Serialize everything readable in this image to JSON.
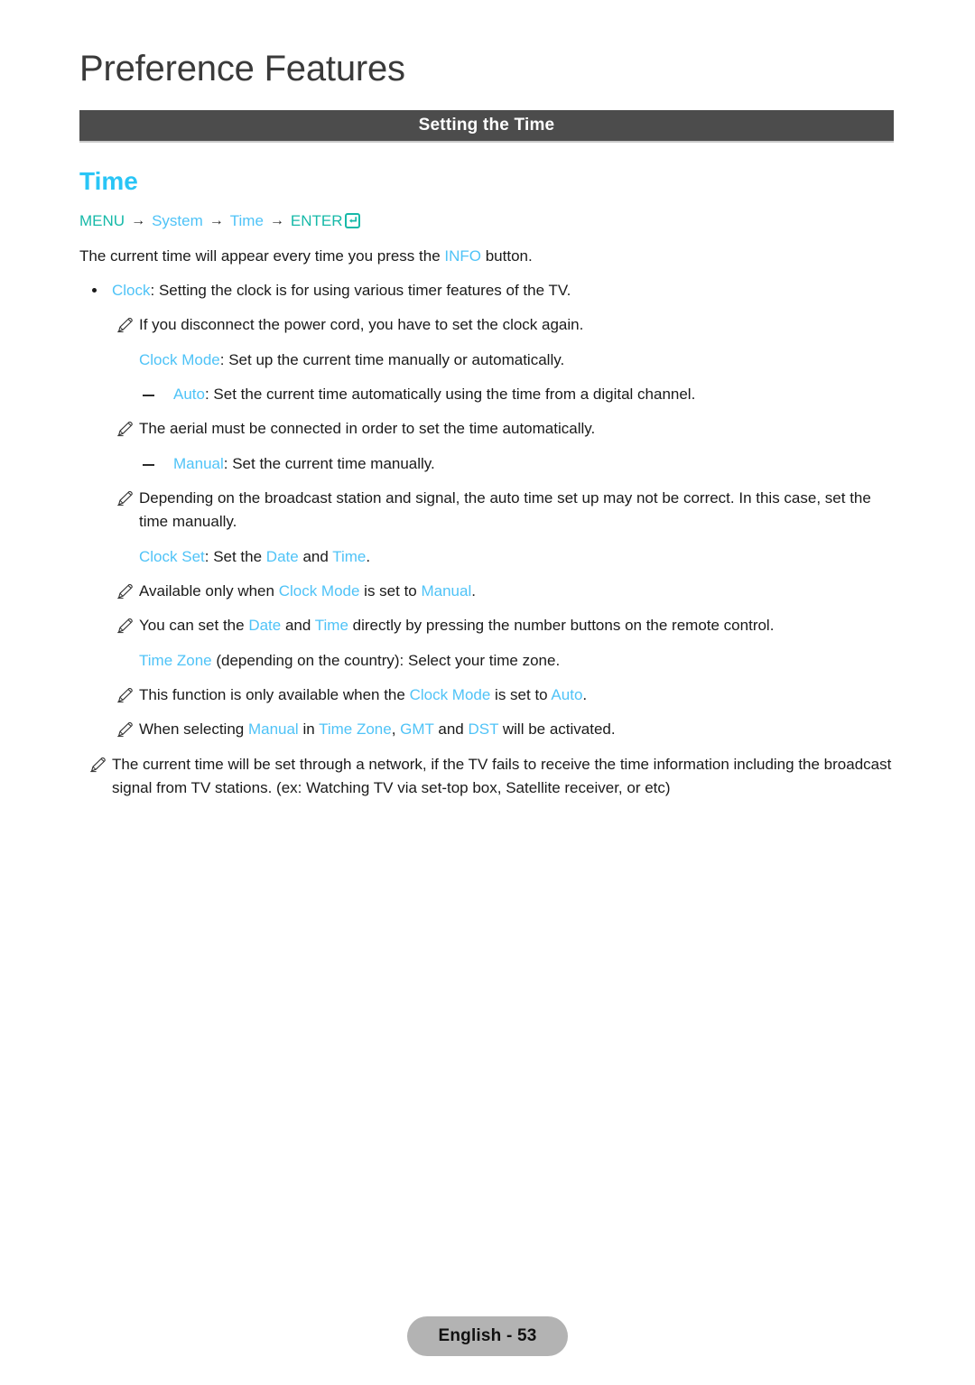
{
  "header": {
    "chapter_title": "Preference Features",
    "section_bar_title": "Setting the Time"
  },
  "content": {
    "feature_heading": "Time",
    "menu_path": {
      "menu_label": "MENU",
      "arrow": "→",
      "system_label": "System",
      "time_label": "Time",
      "enter_label": "ENTER",
      "enter_icon": "enter-return-icon"
    },
    "intro": {
      "before_kw": "The current time will appear every time you press the ",
      "kw": "INFO",
      "after_kw": " button."
    },
    "items": [
      {
        "type": "bullet",
        "kw": "Clock",
        "text": ": Setting the clock is for using various timer features of the TV.",
        "icon": "bullet-dot"
      },
      {
        "type": "note",
        "icon": "pencil-note-icon",
        "text": "If you disconnect the power cord, you have to set the clock again."
      },
      {
        "type": "sub",
        "kw": "Clock Mode",
        "text": ": Set up the current time manually or automatically."
      },
      {
        "type": "dash",
        "icon": "dash-marker",
        "kw": "Auto",
        "text": ": Set the current time automatically using the time from a digital channel."
      },
      {
        "type": "note",
        "icon": "pencil-note-icon",
        "text": "The aerial must be connected in order to set the time automatically."
      },
      {
        "type": "dash",
        "icon": "dash-marker",
        "kw": "Manual",
        "text": ": Set the current time manually."
      },
      {
        "type": "note",
        "icon": "pencil-note-icon",
        "text": "Depending on the broadcast station and signal, the auto time set up may not be correct. In this case, set the time manually."
      },
      {
        "type": "sub-multi",
        "segments": [
          {
            "kw": "Clock Set"
          },
          {
            "plain": ": Set the "
          },
          {
            "kw": "Date"
          },
          {
            "plain": " and "
          },
          {
            "kw": "Time"
          },
          {
            "plain": "."
          }
        ]
      },
      {
        "type": "note-multi",
        "icon": "pencil-note-icon",
        "segments": [
          {
            "plain": "Available only when "
          },
          {
            "kw": "Clock Mode"
          },
          {
            "plain": " is set to "
          },
          {
            "kw": "Manual"
          },
          {
            "plain": "."
          }
        ]
      },
      {
        "type": "note-multi",
        "icon": "pencil-note-icon",
        "segments": [
          {
            "plain": "You can set the "
          },
          {
            "kw": "Date"
          },
          {
            "plain": " and "
          },
          {
            "kw": "Time"
          },
          {
            "plain": " directly by pressing the number buttons on the remote control."
          }
        ]
      },
      {
        "type": "sub-multi",
        "segments": [
          {
            "kw": "Time Zone"
          },
          {
            "plain": " (depending on the country): Select your time zone."
          }
        ]
      },
      {
        "type": "note-multi",
        "icon": "pencil-note-icon",
        "segments": [
          {
            "plain": "This function is only available when the "
          },
          {
            "kw": "Clock Mode"
          },
          {
            "plain": " is set to "
          },
          {
            "kw": "Auto"
          },
          {
            "plain": "."
          }
        ]
      },
      {
        "type": "note-multi",
        "icon": "pencil-note-icon",
        "segments": [
          {
            "plain": "When selecting "
          },
          {
            "kw": "Manual"
          },
          {
            "plain": " in "
          },
          {
            "kw": "Time Zone"
          },
          {
            "plain": ", "
          },
          {
            "kw": "GMT"
          },
          {
            "plain": " and "
          },
          {
            "kw": "DST"
          },
          {
            "plain": " will be activated."
          }
        ]
      },
      {
        "type": "note-out",
        "icon": "pencil-note-icon",
        "text": "The current time will be set through a network, if the TV fails to receive the time information including the broadcast signal from TV stations. (ex: Watching TV via set-top box, Satellite receiver, or etc)"
      }
    ]
  },
  "footer": {
    "page_label": "English - 53"
  },
  "colors": {
    "heading_blue": "#29c5f6",
    "keyword_blue": "#4fc3f7",
    "menu_teal": "#16b9a8",
    "section_bar": "#4c4c4c",
    "footer_pill": "#b3b3b3",
    "body_text": "#1a1a1a"
  }
}
